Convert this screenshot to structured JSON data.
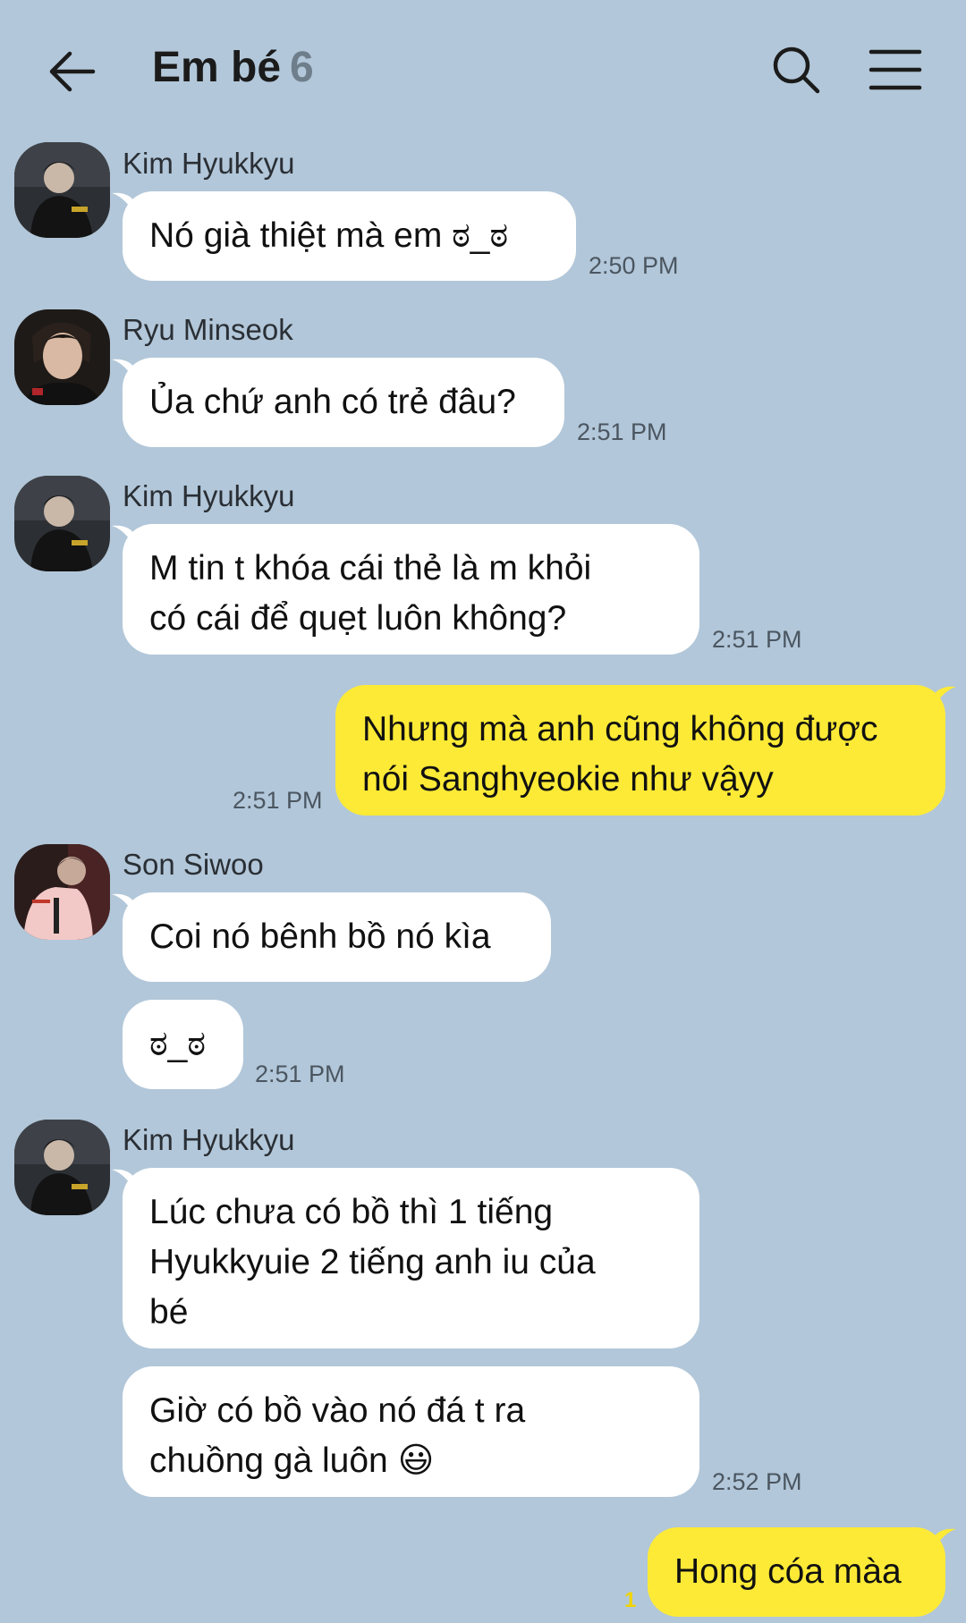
{
  "header": {
    "title": "Em bé",
    "member_count": "6",
    "icons": [
      "back-arrow-icon",
      "search-icon",
      "menu-icon"
    ]
  },
  "messages": [
    {
      "sender": "Kim Hyukkyu",
      "text": "Nó già thiệt mà em ಠ_ಠ",
      "time": "2:50 PM"
    },
    {
      "sender": "Ryu Minseok",
      "text": "Ủa chứ anh có trẻ đâu?",
      "time": "2:51 PM"
    },
    {
      "sender": "Kim Hyukkyu",
      "text_line1": "M tin t khóa cái thẻ là m khỏi",
      "text_line2": "có cái để quẹt luôn không?",
      "time": "2:51 PM"
    },
    {
      "sender": "me",
      "text_line1": "Nhưng mà anh cũng không được",
      "text_line2": "nói Sanghyeokie như vậyy",
      "time": "2:51 PM"
    },
    {
      "sender": "Son Siwoo",
      "text": "Coi nó bênh bồ nó kìa",
      "text2": "ಠ_ಠ",
      "time": "2:51 PM"
    },
    {
      "sender": "Kim Hyukkyu",
      "text_line1": "Lúc chưa có bồ thì 1 tiếng",
      "text_line2": "Hyukkyuie 2 tiếng anh iu của",
      "text_line3": "bé",
      "text2_line1": "Giờ có bồ vào nó đá t ra",
      "text2_line2": "chuồng gà luôn 😃",
      "time": "2:52 PM"
    },
    {
      "sender": "me",
      "text": "Hong cóa màa",
      "unread": "1"
    }
  ],
  "colors": {
    "background": "#b2c7d9",
    "incoming_bubble": "#ffffff",
    "outgoing_bubble": "#fdea36"
  }
}
